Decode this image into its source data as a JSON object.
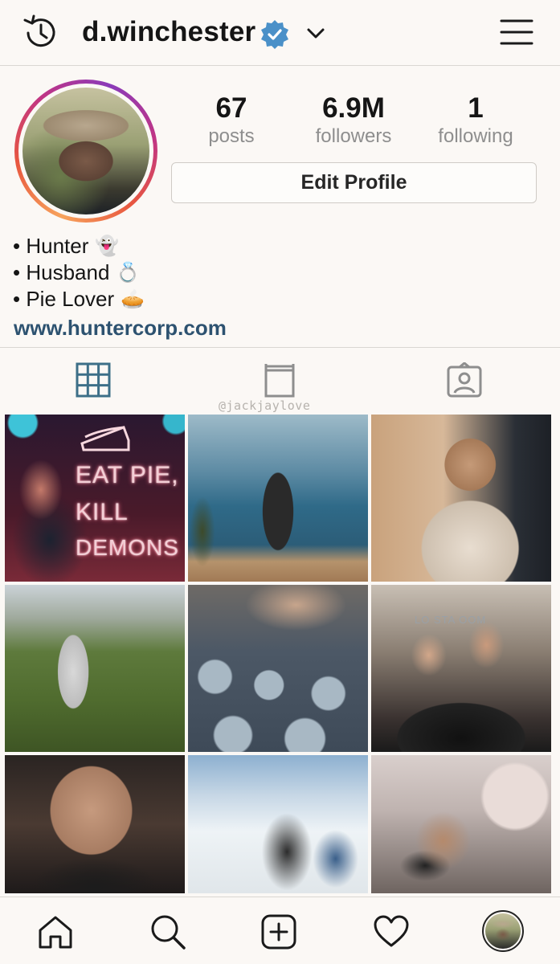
{
  "header": {
    "username": "d.winchester",
    "history_icon": "history-icon",
    "verified_icon": "verified-badge-icon",
    "chevron_icon": "chevron-down-icon",
    "menu_icon": "hamburger-menu-icon"
  },
  "profile": {
    "stats": [
      {
        "value": "67",
        "label": "posts"
      },
      {
        "value": "6.9M",
        "label": "followers"
      },
      {
        "value": "1",
        "label": "following"
      }
    ],
    "edit_button": "Edit Profile",
    "bio": [
      {
        "text": "• Hunter",
        "emoji": "👻"
      },
      {
        "text": "• Husband",
        "emoji": "💍"
      },
      {
        "text": "• Pie Lover",
        "emoji": "🥧"
      }
    ],
    "link": "www.huntercorp.com"
  },
  "tabs": [
    {
      "name": "grid",
      "icon": "grid-icon",
      "active": true
    },
    {
      "name": "igtv",
      "icon": "igtv-icon",
      "active": false
    },
    {
      "name": "tagged",
      "icon": "tagged-user-icon",
      "active": false
    }
  ],
  "watermark": "@jackjaylove",
  "posts": {
    "neon_sign": [
      "EAT PIE,",
      "KILL",
      "DEMONS"
    ],
    "event_sign": "LO STA   OOM"
  },
  "bottom_nav": [
    {
      "name": "home",
      "icon": "home-icon"
    },
    {
      "name": "search",
      "icon": "search-icon"
    },
    {
      "name": "new-post",
      "icon": "add-post-icon"
    },
    {
      "name": "activity",
      "icon": "heart-icon"
    },
    {
      "name": "profile",
      "icon": "profile-avatar"
    }
  ],
  "colors": {
    "background": "#fbf8f5",
    "link": "#2d5270",
    "active_tab": "#3d6f88",
    "muted": "#8e8e8e",
    "verified": "#4a90c8"
  }
}
